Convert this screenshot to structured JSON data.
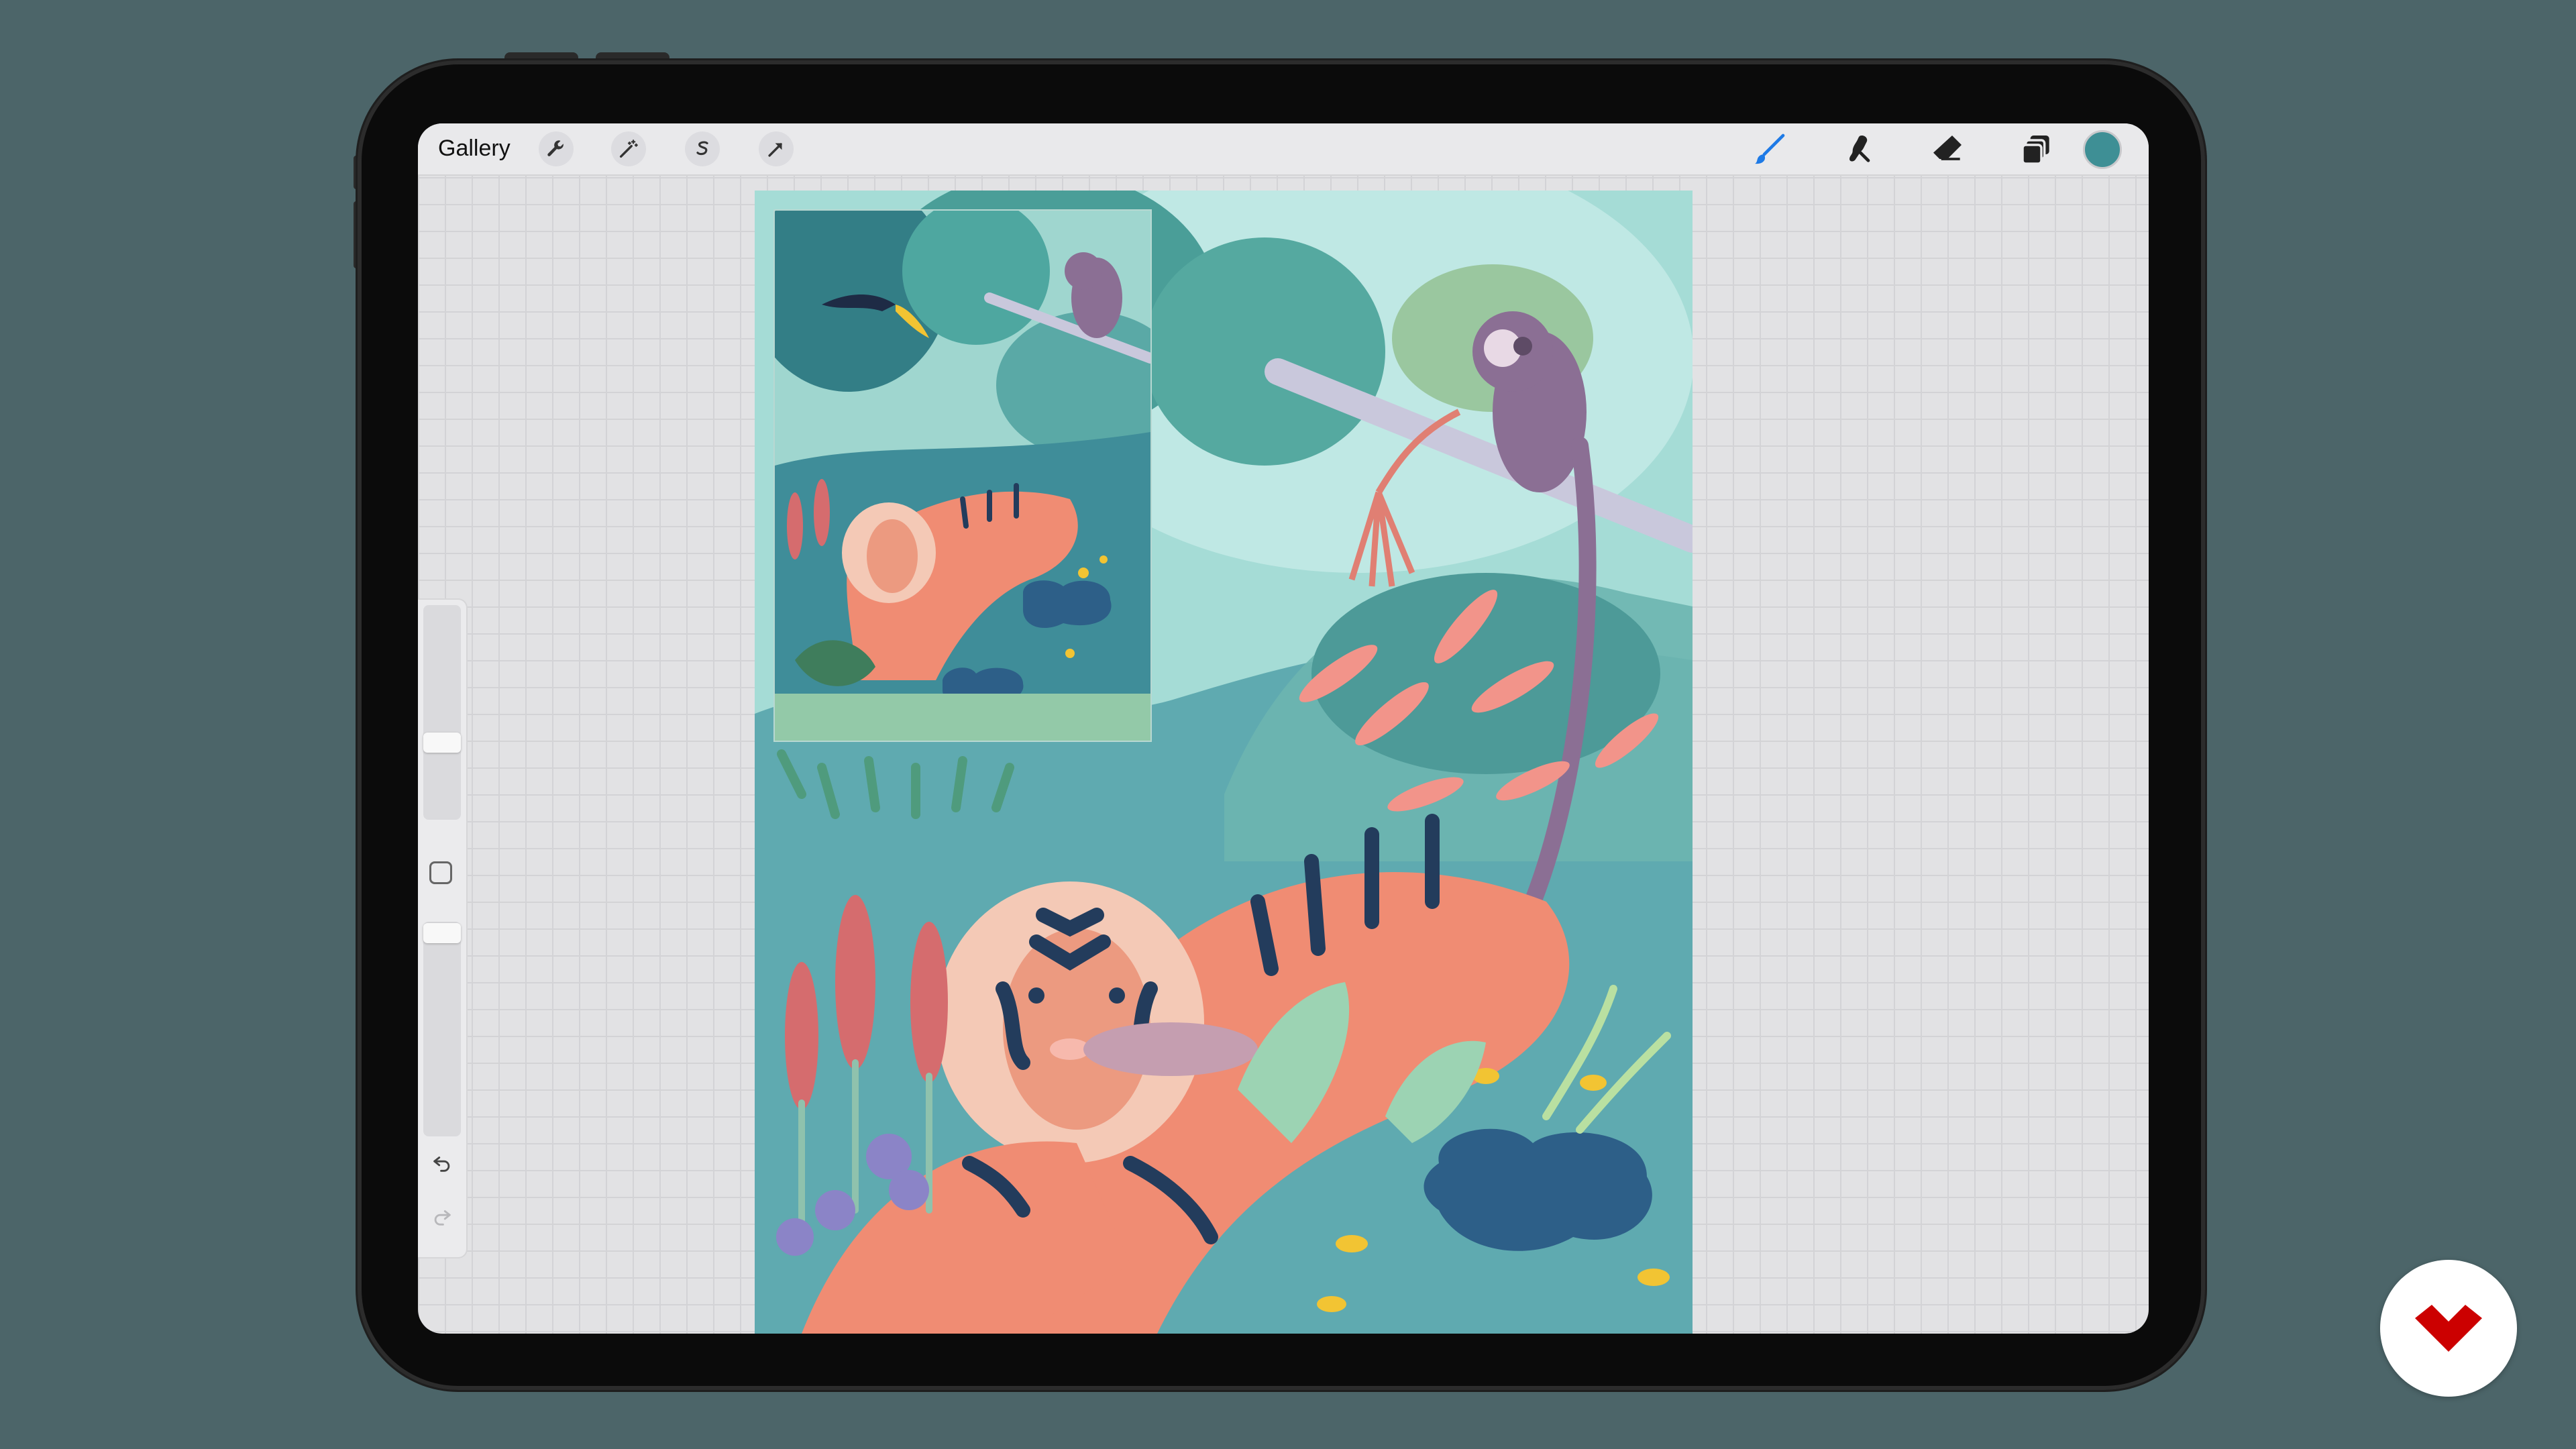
{
  "toolbar": {
    "gallery_label": "Gallery",
    "left_icons": [
      "wrench-icon",
      "magic-wand-icon",
      "selection-s-icon",
      "transform-arrow-icon"
    ],
    "right_icons": [
      "brush-icon",
      "smudge-icon",
      "eraser-icon",
      "layers-icon"
    ],
    "active_tool": "brush-icon",
    "current_color": "#3e8f95"
  },
  "sidebar": {
    "brush_size_level": 0.28,
    "opacity_level": 0.03,
    "icons": [
      "modify-square-icon",
      "undo-icon",
      "redo-icon"
    ]
  },
  "colors": {
    "background": "#4c6569",
    "accent_blue": "#1e7ae6",
    "brand_red": "#cc0000"
  }
}
